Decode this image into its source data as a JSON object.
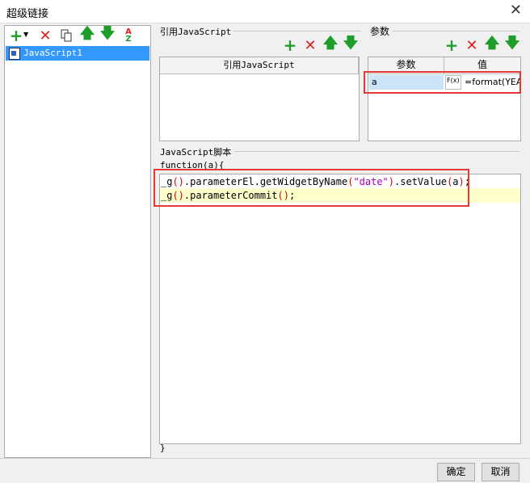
{
  "window": {
    "title": "超级链接"
  },
  "left_panel": {
    "items": [
      "JavaScript1"
    ]
  },
  "ref_section": {
    "group_title": "引用JavaScript",
    "column_header": "引用JavaScript"
  },
  "params_section": {
    "group_title": "参数",
    "columns": [
      "参数",
      "值"
    ],
    "rows": [
      {
        "name": "a",
        "fx": "F(x)",
        "value": "=format(YEA"
      }
    ]
  },
  "script_section": {
    "group_title": "JavaScript脚本",
    "header_line": "function(a){",
    "footer_line": "}",
    "code_lines": [
      [
        {
          "t": "_g",
          "c": "plain"
        },
        {
          "t": "()",
          "c": "paren"
        },
        {
          "t": ".parameterEl.getWidgetByName",
          "c": "plain"
        },
        {
          "t": "(",
          "c": "paren"
        },
        {
          "t": "\"date\"",
          "c": "str"
        },
        {
          "t": ")",
          "c": "paren"
        },
        {
          "t": ".setValue",
          "c": "plain"
        },
        {
          "t": "(",
          "c": "paren"
        },
        {
          "t": "a",
          "c": "plain"
        },
        {
          "t": ")",
          "c": "paren"
        },
        {
          "t": ";",
          "c": "plain"
        }
      ],
      [
        {
          "t": "_g",
          "c": "plain"
        },
        {
          "t": "()",
          "c": "paren"
        },
        {
          "t": ".parameterCommit",
          "c": "plain"
        },
        {
          "t": "()",
          "c": "paren"
        },
        {
          "t": ";",
          "c": "plain"
        }
      ]
    ]
  },
  "footer": {
    "ok": "确定",
    "cancel": "取消"
  },
  "colors": {
    "selection": "#3399ff",
    "highlight_line": "#ffffcc",
    "red_box": "#e53935",
    "green_icon": "#1f9d2b",
    "red_icon": "#e02020",
    "string": "#b000b0",
    "paren": "#d00000"
  }
}
